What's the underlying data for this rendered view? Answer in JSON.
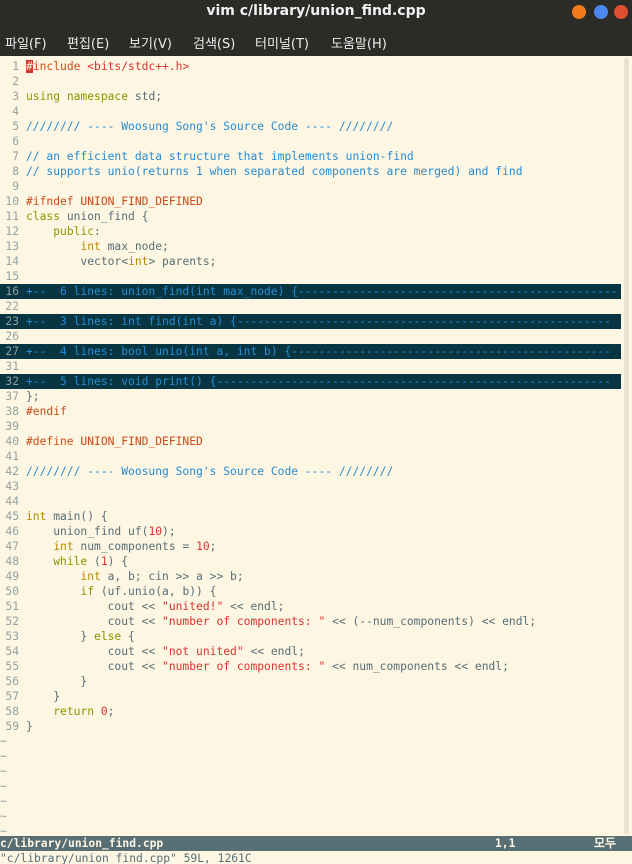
{
  "window": {
    "title": "vim c/library/union_find.cpp",
    "buttons": [
      {
        "name": "minimize",
        "color": "#f37a1d"
      },
      {
        "name": "maximize",
        "color": "#4a87ee"
      },
      {
        "name": "close",
        "color": "#dd4f2e"
      }
    ]
  },
  "menu": [
    {
      "label": "파일(F)"
    },
    {
      "label": "편집(E)"
    },
    {
      "label": "보기(V)"
    },
    {
      "label": "검색(S)"
    },
    {
      "label": "터미널(T)"
    },
    {
      "label": "도움말(H)"
    }
  ],
  "editor": {
    "lines": [
      {
        "n": "1",
        "t": "#include <bits/stdc++.h>"
      },
      {
        "n": "2",
        "t": ""
      },
      {
        "n": "3",
        "t": "using namespace std;"
      },
      {
        "n": "4",
        "t": ""
      },
      {
        "n": "5",
        "t": "//////// ---- Woosung Song's Source Code ---- ////////"
      },
      {
        "n": "6",
        "t": ""
      },
      {
        "n": "7",
        "t": "// an efficient data structure that implements union-find"
      },
      {
        "n": "8",
        "t": "// supports unio(returns 1 when separated components are merged) and find"
      },
      {
        "n": "9",
        "t": ""
      },
      {
        "n": "10",
        "t": "#ifndef UNION_FIND_DEFINED"
      },
      {
        "n": "11",
        "t": "class union_find {"
      },
      {
        "n": "12",
        "t": "    public:"
      },
      {
        "n": "13",
        "t": "        int max_node;"
      },
      {
        "n": "14",
        "t": "        vector<int> parents;"
      },
      {
        "n": "15",
        "t": ""
      },
      {
        "n": "16",
        "t": "+--  6 lines: union_find(int max_node) {-----------------------------------------------",
        "fold": true
      },
      {
        "n": "22",
        "t": ""
      },
      {
        "n": "23",
        "t": "+--  3 lines: int find(int a) {-------------------------------------------------------",
        "fold": true
      },
      {
        "n": "26",
        "t": ""
      },
      {
        "n": "27",
        "t": "+--  4 lines: bool unio(int a, int b) {-----------------------------------------------",
        "fold": true
      },
      {
        "n": "31",
        "t": ""
      },
      {
        "n": "32",
        "t": "+--  5 lines: void print() {----------------------------------------------------------",
        "fold": true
      },
      {
        "n": "37",
        "t": "};"
      },
      {
        "n": "38",
        "t": "#endif"
      },
      {
        "n": "39",
        "t": ""
      },
      {
        "n": "40",
        "t": "#define UNION_FIND_DEFINED"
      },
      {
        "n": "41",
        "t": ""
      },
      {
        "n": "42",
        "t": "//////// ---- Woosung Song's Source Code ---- ////////"
      },
      {
        "n": "43",
        "t": ""
      },
      {
        "n": "44",
        "t": ""
      },
      {
        "n": "45",
        "t": "int main() {"
      },
      {
        "n": "46",
        "t": "    union_find uf(10);"
      },
      {
        "n": "47",
        "t": "    int num_components = 10;"
      },
      {
        "n": "48",
        "t": "    while (1) {"
      },
      {
        "n": "49",
        "t": "        int a, b; cin >> a >> b;"
      },
      {
        "n": "50",
        "t": "        if (uf.unio(a, b)) {"
      },
      {
        "n": "51",
        "t": "            cout << \"united!\" << endl;"
      },
      {
        "n": "52",
        "t": "            cout << \"number of components: \" << (--num_components) << endl;"
      },
      {
        "n": "53",
        "t": "        } else {"
      },
      {
        "n": "54",
        "t": "            cout << \"not united\" << endl;"
      },
      {
        "n": "55",
        "t": "            cout << \"number of components: \" << num_components << endl;"
      },
      {
        "n": "56",
        "t": "        }"
      },
      {
        "n": "57",
        "t": "    }"
      },
      {
        "n": "58",
        "t": "    return 0;"
      },
      {
        "n": "59",
        "t": "}"
      }
    ],
    "tilde": "~",
    "tilde_rows": 7
  },
  "status": {
    "file": "c/library/union_find.cpp",
    "position": "1,1",
    "percent": "모두"
  },
  "cmdline": "\"c/library/union_find.cpp\" 59L, 1261C",
  "colors": {
    "background": "#fdf6e3",
    "fold_bg": "#073642",
    "comment": "#268bd2",
    "keyword": "#859900",
    "type": "#b58900",
    "string": "#dc322f",
    "preproc": "#cb4b16"
  }
}
